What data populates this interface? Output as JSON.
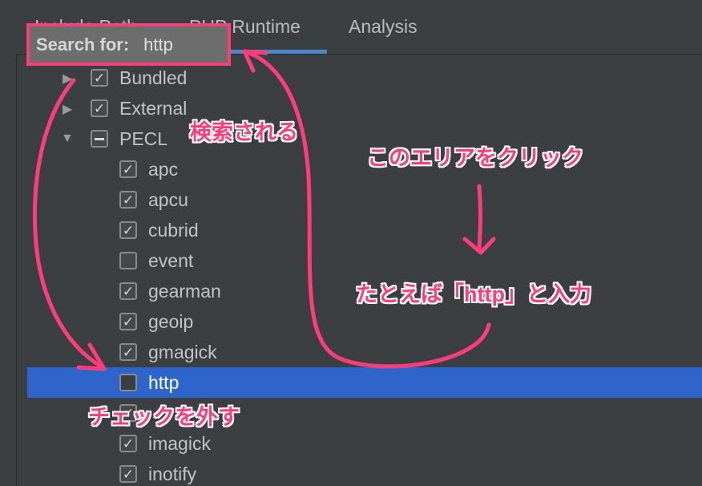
{
  "tabs": [
    {
      "label": "Include Path"
    },
    {
      "label": "PHP Runtime"
    },
    {
      "label": "Analysis"
    }
  ],
  "search": {
    "label": "Search for:",
    "value": "http"
  },
  "tree": {
    "groups": [
      {
        "label": "Bundled",
        "checked": true,
        "expanded": false
      },
      {
        "label": "External",
        "checked": true,
        "expanded": false
      },
      {
        "label": "PECL",
        "checked": "partial",
        "expanded": true
      }
    ],
    "pecl_items": [
      {
        "label": "apc",
        "checked": true
      },
      {
        "label": "apcu",
        "checked": true
      },
      {
        "label": "cubrid",
        "checked": true
      },
      {
        "label": "event",
        "checked": false
      },
      {
        "label": "gearman",
        "checked": true
      },
      {
        "label": "geoip",
        "checked": true
      },
      {
        "label": "gmagick",
        "checked": true
      },
      {
        "label": "http",
        "checked": false,
        "selected": true
      },
      {
        "label": "",
        "checked": true
      },
      {
        "label": "imagick",
        "checked": true
      },
      {
        "label": "inotify",
        "checked": true
      }
    ]
  },
  "annotations": {
    "searched": "検索される",
    "click_area": "このエリアをクリック",
    "example_input": "たとえば「http」と入力",
    "uncheck": "チェックを外す"
  },
  "colors": {
    "accent": "#ff3d7a",
    "selection": "#2f65ca",
    "tab_underline": "#4a88c7",
    "background": "#3c3f41"
  }
}
